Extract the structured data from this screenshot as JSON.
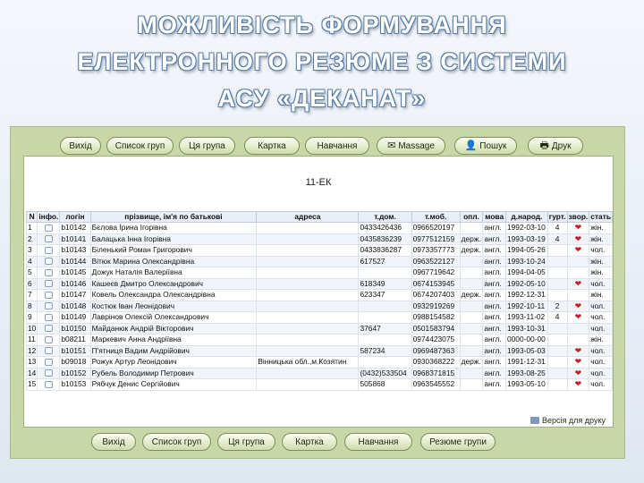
{
  "title_lines": [
    "МОЖЛИВІСТЬ ФОРМУВАННЯ",
    "ЕЛЕКТРОННОГО РЕЗЮМЕ З СИСТЕМИ",
    "АСУ «ДЕКАНАТ»"
  ],
  "toolbar": {
    "exit": "Вихід",
    "groups_list": "Список груп",
    "this_group": "Ця група",
    "card": "Картка",
    "study": "Навчання",
    "message": "Massage",
    "search": "Пошук",
    "print": "Друк"
  },
  "group_name": "11-ЕК",
  "table": {
    "headers": [
      "N",
      "інфо.",
      "логін",
      "прізвище, ім'я по батькові",
      "адреса",
      "т.дом.",
      "т.моб.",
      "опл.",
      "мова",
      "д.народ.",
      "гурт.",
      "звор.",
      "стать"
    ],
    "rows": [
      [
        "1",
        "b10142",
        "Бєлова Ірина Ігорівна",
        "",
        "0433426436",
        "0966520197",
        "",
        "англ.",
        "1992-03-10",
        "4",
        "❤",
        "жін."
      ],
      [
        "2",
        "b10141",
        "Балацька Інна Ігорівна",
        "",
        "0435836239",
        "0977512159",
        "держ.",
        "англ.",
        "1993-03-19",
        "4",
        "❤",
        "жін."
      ],
      [
        "3",
        "b10143",
        "Біленький Роман Григорович",
        "",
        "0433836287",
        "0973357773",
        "держ.",
        "англ.",
        "1994-05-26",
        "",
        "❤",
        "чол."
      ],
      [
        "4",
        "b10144",
        "Вітюк Марина Олександрівна",
        "",
        "617527",
        "0963522127",
        "",
        "англ.",
        "1993-10-24",
        "",
        "",
        "жін."
      ],
      [
        "5",
        "b10145",
        "Дожук Наталія Валеріївна",
        "",
        "",
        "0967719642",
        "",
        "англ.",
        "1994-04-05",
        "",
        "",
        "жін."
      ],
      [
        "6",
        "b10146",
        "Кашеєв Дмитро Олександрович",
        "",
        "618349",
        "0674153945",
        "",
        "англ.",
        "1992-05-10",
        "",
        "❤",
        "чол."
      ],
      [
        "7",
        "b10147",
        "Ковель Олександра Олександрівна",
        "",
        "623347",
        "0674207403",
        "держ.",
        "англ.",
        "1992-12-31",
        "",
        "",
        "жін."
      ],
      [
        "8",
        "b10148",
        "Костюк Іван Леонідович",
        "",
        "",
        "0932919269",
        "",
        "англ.",
        "1992-10-11",
        "2",
        "❤",
        "чол."
      ],
      [
        "9",
        "b10149",
        "Лаврінов Олексій Олександрович",
        "",
        "",
        "0988154582",
        "",
        "англ.",
        "1993-11-02",
        "4",
        "❤",
        "чол."
      ],
      [
        "10",
        "b10150",
        "Майданюк Андрій Вікторович",
        "",
        "37647",
        "0501583794",
        "",
        "англ.",
        "1993-10-31",
        "",
        "",
        "чол."
      ],
      [
        "11",
        "b08211",
        "Маркевич Анна Андріївна",
        "",
        "",
        "0974423075",
        "",
        "англ.",
        "0000-00-00",
        "",
        "",
        "жін."
      ],
      [
        "12",
        "b10151",
        "П'ятниця Вадим Андрійович",
        "",
        "587234",
        "0969487363",
        "",
        "англ.",
        "1993-05-03",
        "",
        "❤",
        "чол."
      ],
      [
        "13",
        "b09018",
        "Рожук Артур Леонідович",
        "Вінницька обл.,м.Козятин",
        "",
        "0930368222",
        "держ.",
        "англ.",
        "1991-12-31",
        "",
        "❤",
        "чол."
      ],
      [
        "14",
        "b10152",
        "Рубель Володимир Петрович",
        "",
        "(0432)533504",
        "0968371815",
        "",
        "англ.",
        "1993-08-25",
        "",
        "❤",
        "чол."
      ],
      [
        "15",
        "b10153",
        "Рябчук Денис Сергійович",
        "",
        "505868",
        "0963545552",
        "",
        "англ.",
        "1993-05-10",
        "",
        "❤",
        "чол."
      ]
    ]
  },
  "version_label": "Версія для друку",
  "bottombar": {
    "exit": "Вихід",
    "groups_list": "Список груп",
    "this_group": "Ця група",
    "card": "Картка",
    "study": "Навчання",
    "resume_groups": "Резюме групи"
  },
  "colors": {
    "app_bg": "#c8d6a8",
    "panel_bg": "#ffffff",
    "heart": "#c81e1e",
    "title_outline": "#5b7fa6"
  }
}
